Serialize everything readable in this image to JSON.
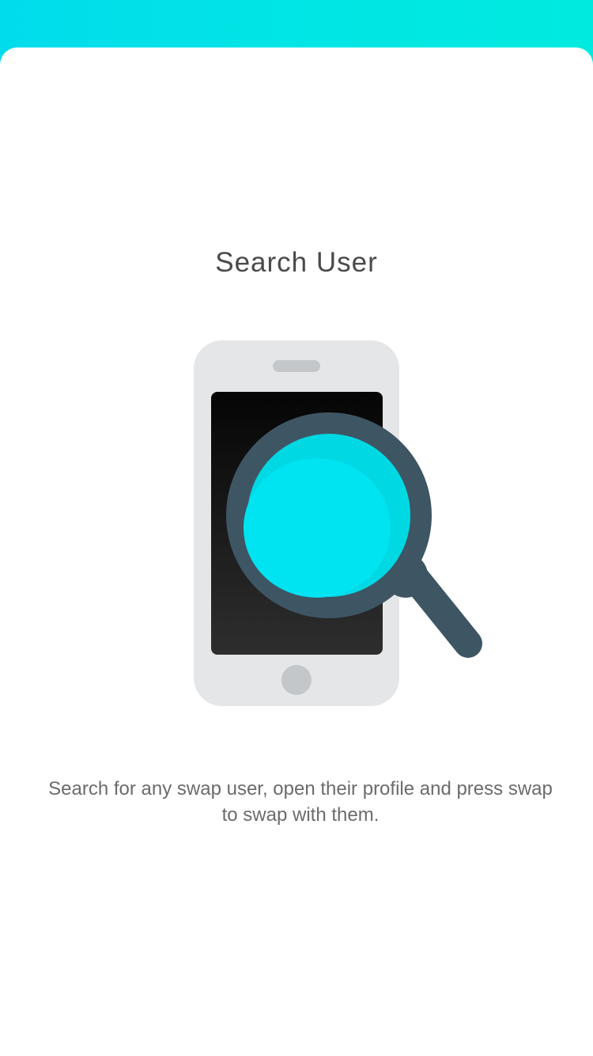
{
  "header": {
    "accent_color": "#00e4e6"
  },
  "onboarding": {
    "title": "Search User",
    "description": "Search for any swap user, open their profile and press swap to swap with them.",
    "illustration": {
      "icon_name": "phone-with-magnifier-icon",
      "lens_color": "#00e4f2",
      "handle_color": "#3e5564"
    }
  }
}
